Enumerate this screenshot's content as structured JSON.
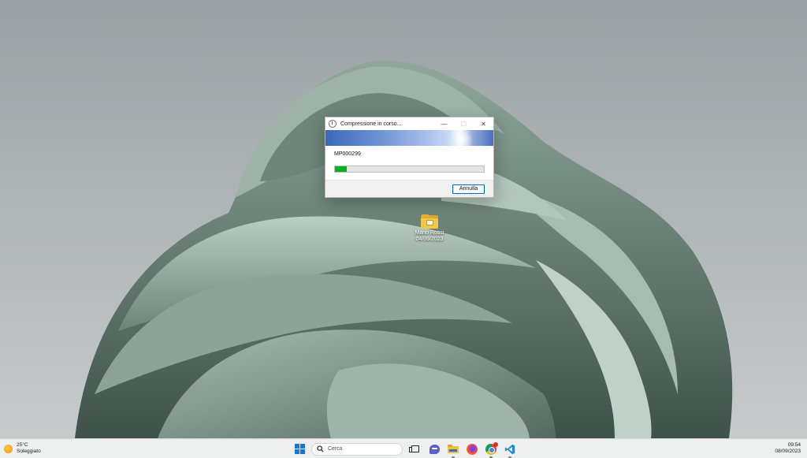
{
  "dialog": {
    "title": "Compressione in corso...",
    "item_name": "MP000299",
    "progress_percent": 8,
    "cancel_label": "Annulla",
    "close_glyph": "✕",
    "minimize_glyph": "—",
    "maximize_glyph": "☐"
  },
  "desktop": {
    "icons": [
      {
        "label_line1": "Mario Rossi",
        "label_line2": "04/09/2023",
        "icon": "image-folder-icon"
      }
    ]
  },
  "taskbar": {
    "weather": {
      "temperature": "25°C",
      "condition": "Soleggiato",
      "icon": "sun-icon"
    },
    "search_placeholder": "Cerca",
    "apps": [
      "start-icon",
      "search-icon",
      "task-view-icon",
      "chat-icon",
      "file-explorer-icon",
      "firefox-icon",
      "chrome-icon",
      "vscode-icon"
    ],
    "clock": {
      "time": "09:54",
      "date": "08/09/2023"
    }
  },
  "colors": {
    "progress_green": "#06b025",
    "accent_blue": "#0067c0",
    "taskbar_bg": "#eef0f0"
  }
}
